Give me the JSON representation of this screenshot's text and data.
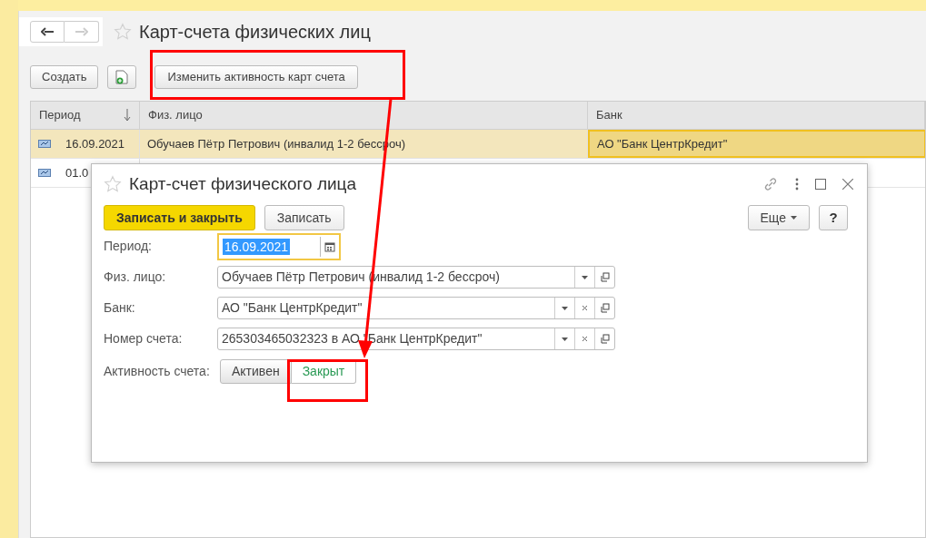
{
  "page": {
    "title": "Карт-счета физических лиц",
    "toolbar": {
      "create": "Создать",
      "change_activity": "Изменить активность карт счета"
    },
    "table": {
      "columns": [
        {
          "label": "Период",
          "sorted": true
        },
        {
          "label": "Физ. лицо",
          "sorted": false
        },
        {
          "label": "Банк",
          "sorted": false
        }
      ],
      "rows": [
        {
          "selected": true,
          "cells": [
            "16.09.2021",
            "Обучаев Пётр Петрович (инвалид 1-2 бессроч)",
            "АО \"Банк ЦентрКредит\""
          ]
        },
        {
          "selected": false,
          "cells": [
            "01.0"
          ]
        }
      ]
    }
  },
  "dialog": {
    "title": "Карт-счет физического лица",
    "buttons": {
      "save_close": "Записать и закрыть",
      "save": "Записать",
      "more": "Еще",
      "help": "?"
    },
    "fields": [
      {
        "kind": "date",
        "label": "Период:",
        "value": "16.09.2021"
      },
      {
        "kind": "ref",
        "label": "Физ. лицо:",
        "value": "Обучаев Пётр Петрович (инвалид 1-2 бессроч)",
        "clearable": false
      },
      {
        "kind": "ref",
        "label": "Банк:",
        "value": "АО \"Банк ЦентрКредит\"",
        "clearable": true
      },
      {
        "kind": "ref",
        "label": "Номер счета:",
        "value": "265303465032323 в АО \"Банк ЦентрКредит\"",
        "clearable": true
      }
    ],
    "activity": {
      "label": "Активность счета:",
      "options": [
        {
          "label": "Активен",
          "selected": false
        },
        {
          "label": "Закрыт",
          "selected": true
        }
      ]
    }
  }
}
